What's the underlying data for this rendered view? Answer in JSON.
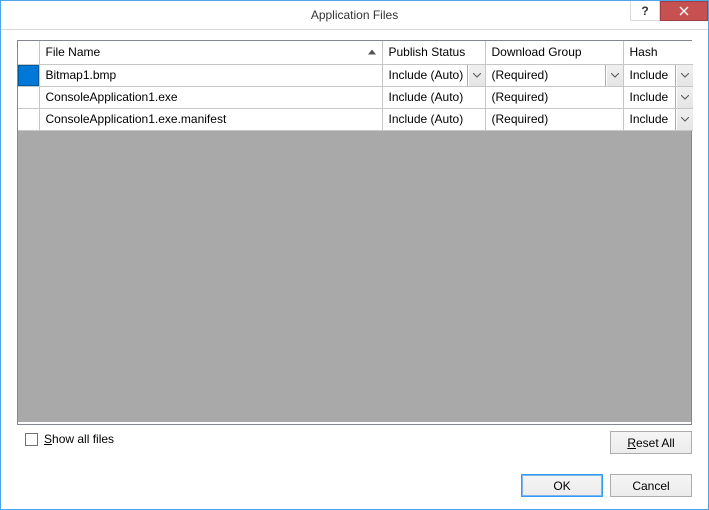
{
  "title": "Application Files",
  "columns": {
    "file_name": "File Name",
    "publish_status": "Publish Status",
    "download_group": "Download Group",
    "hash": "Hash"
  },
  "rows": [
    {
      "selected": true,
      "file": "Bitmap1.bmp",
      "publish": "Include (Auto)",
      "publish_dd": true,
      "group": "(Required)",
      "group_dd": true,
      "hash": "Include",
      "hash_dd": true
    },
    {
      "selected": false,
      "file": "ConsoleApplication1.exe",
      "publish": "Include (Auto)",
      "publish_dd": false,
      "group": "(Required)",
      "group_dd": false,
      "hash": "Include",
      "hash_dd": true
    },
    {
      "selected": false,
      "file": "ConsoleApplication1.exe.manifest",
      "publish": "Include (Auto)",
      "publish_dd": false,
      "group": "(Required)",
      "group_dd": false,
      "hash": "Include",
      "hash_dd": true
    }
  ],
  "show_all_files_label_pre": "S",
  "show_all_files_label_post": "how all files",
  "reset_pre": "R",
  "reset_post": "eset All",
  "ok_label": "OK",
  "cancel_label": "Cancel"
}
